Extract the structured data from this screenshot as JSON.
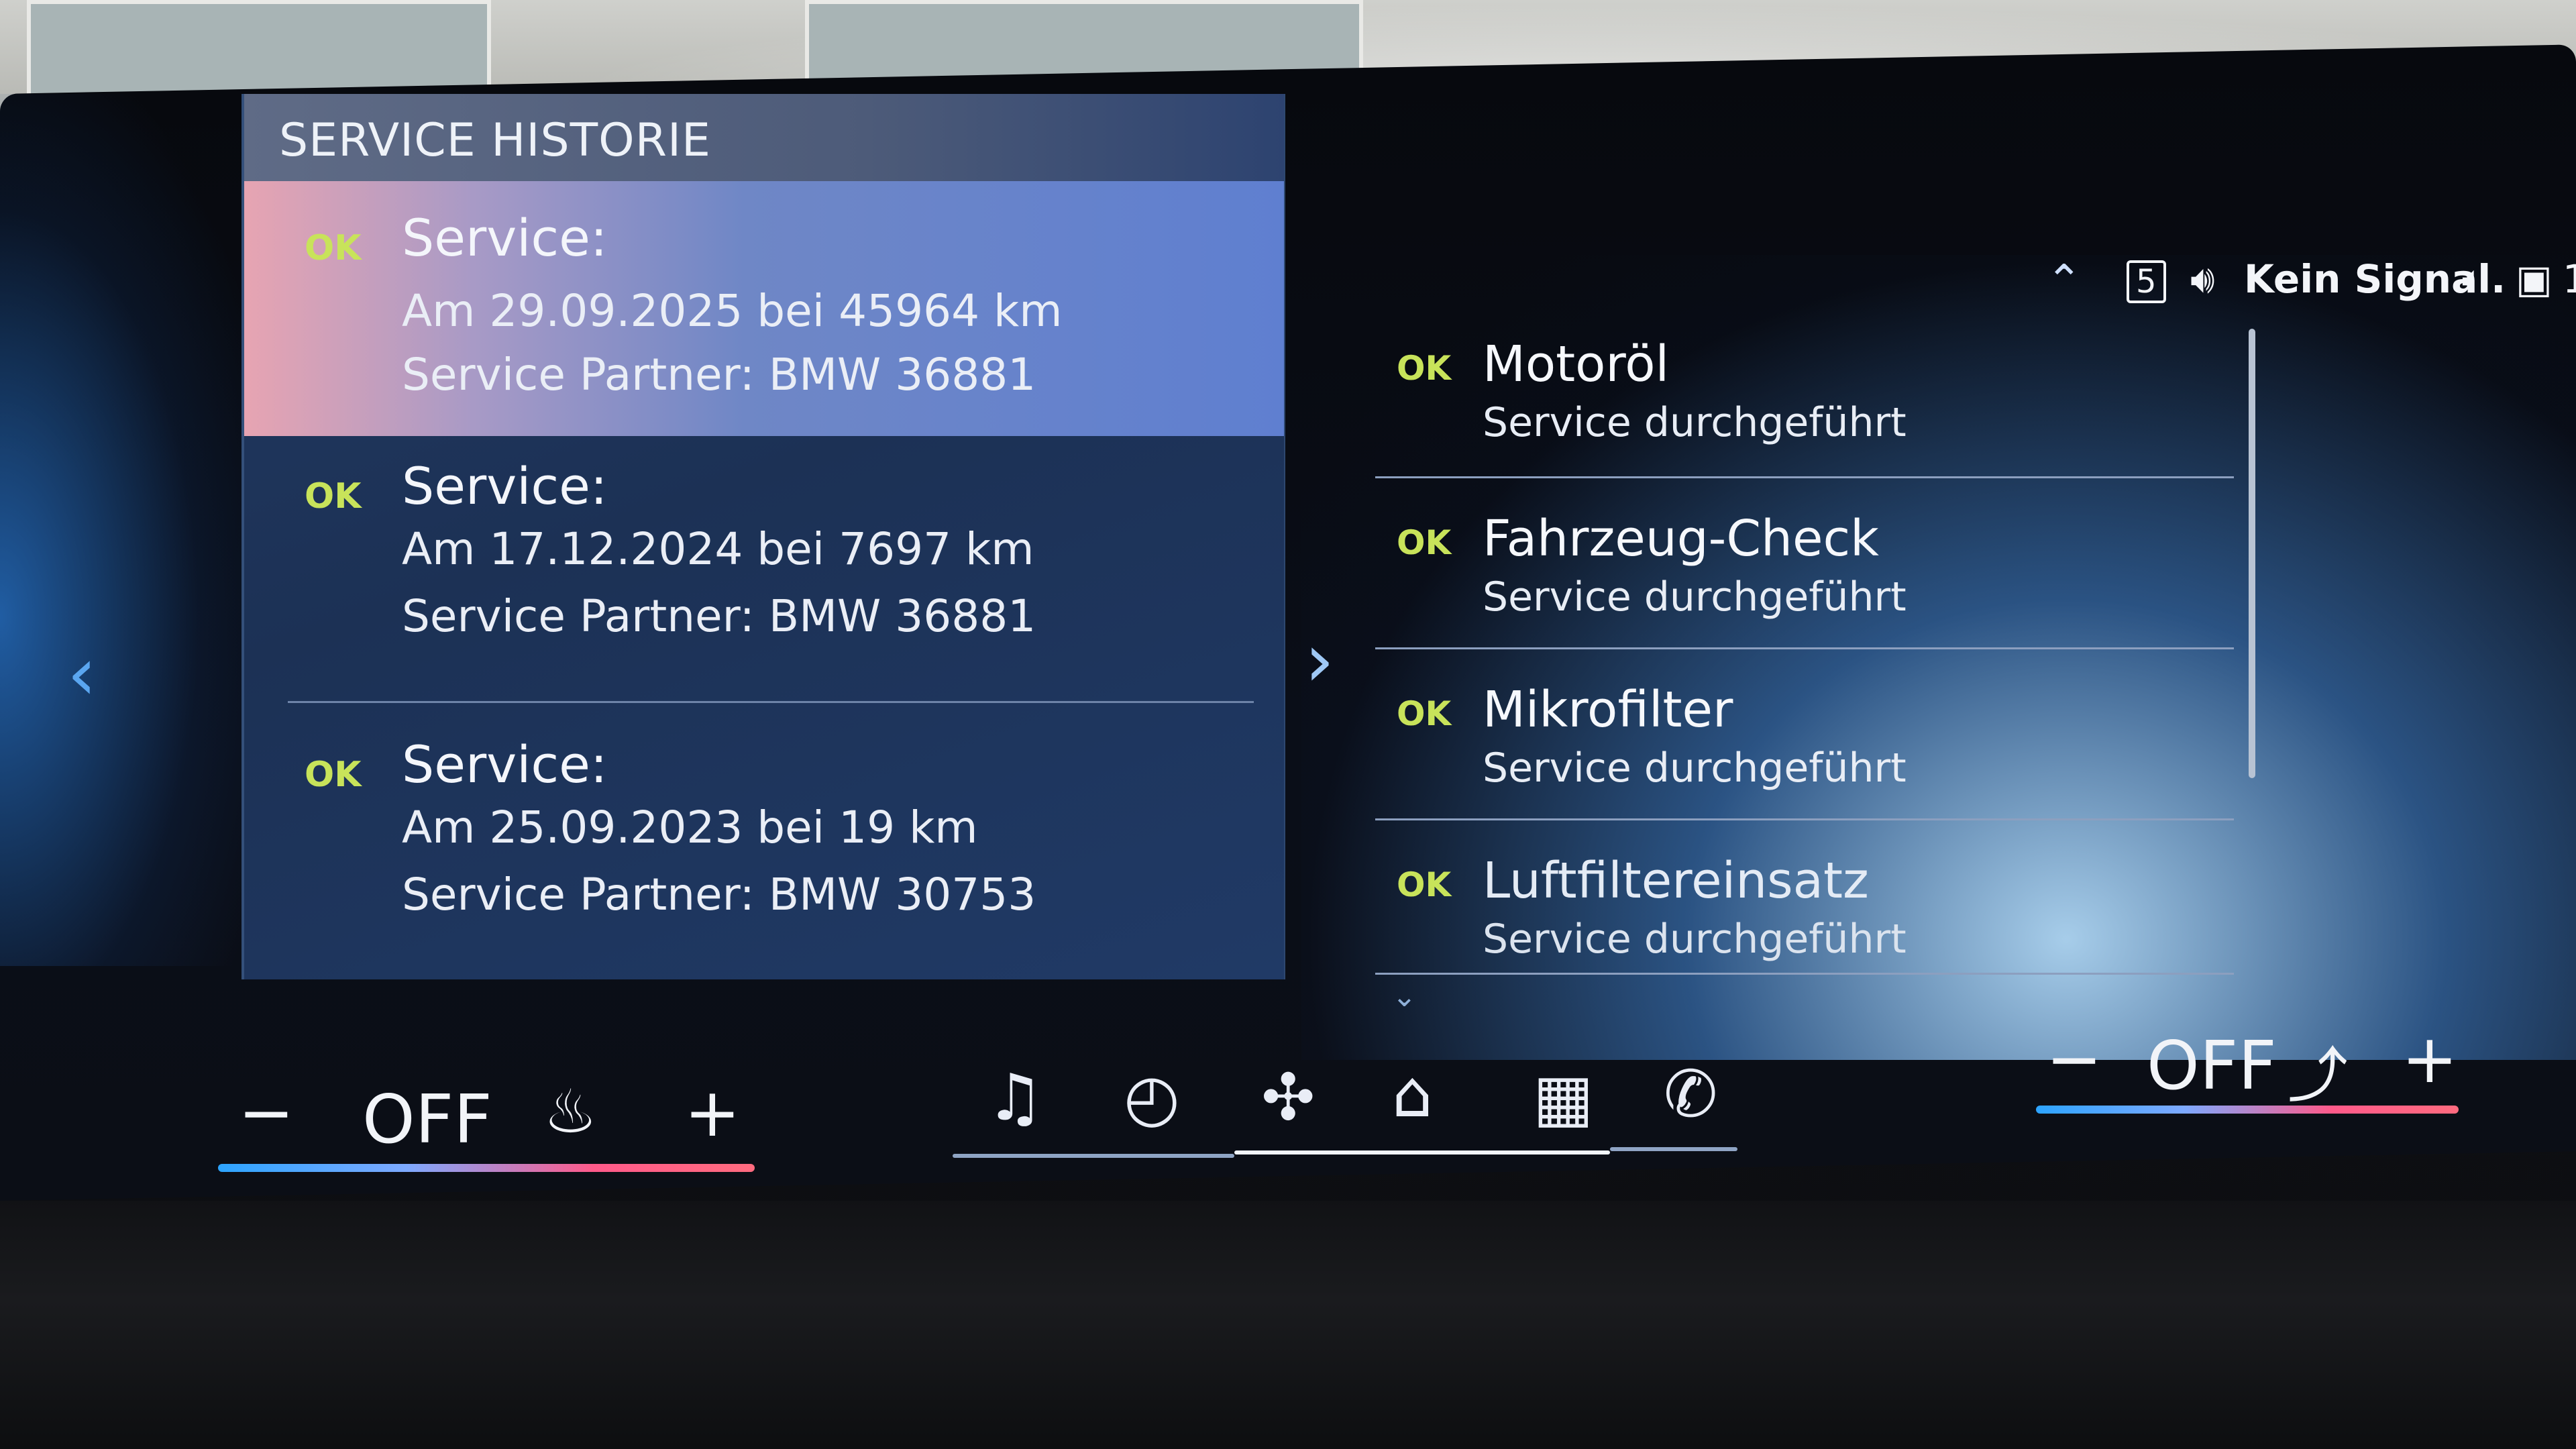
{
  "panel": {
    "title": "SERVICE HISTORIE",
    "entries": [
      {
        "status": "OK",
        "heading": "Service:",
        "date_line": "Am 29.09.2025 bei 45964 km",
        "partner_line": "Service Partner: BMW 36881"
      },
      {
        "status": "OK",
        "heading": "Service:",
        "date_line": "Am 17.12.2024 bei 7697 km",
        "partner_line": "Service Partner: BMW 36881"
      },
      {
        "status": "OK",
        "heading": "Service:",
        "date_line": "Am 25.09.2023 bei 19 km",
        "partner_line": "Service Partner: BMW 30753"
      }
    ]
  },
  "details": [
    {
      "status": "OK",
      "title": "Motoröl",
      "subtitle": "Service durchgeführt"
    },
    {
      "status": "OK",
      "title": "Fahrzeug-Check",
      "subtitle": "Service durchgeführt"
    },
    {
      "status": "OK",
      "title": "Mikrofilter",
      "subtitle": "Service durchgeführt"
    },
    {
      "status": "OK",
      "title": "Luftfiltereinsatz",
      "subtitle": "Service durchgeführt"
    }
  ],
  "status_bar": {
    "network": "5",
    "signal_text": "Kein Signal.",
    "profile_count": "1"
  },
  "climate_left": {
    "minus": "−",
    "label": "OFF",
    "plus": "+"
  },
  "climate_right": {
    "minus": "−",
    "label": "OFF",
    "plus": "+"
  },
  "icons": {
    "nav_prev": "chevron-left-icon",
    "nav_next": "chevron-right-icon",
    "media": "music-note-icon",
    "navigation": "compass-icon",
    "fan": "fan-icon",
    "home": "home-icon",
    "apps": "apps-grid-icon",
    "phone": "phone-icon"
  },
  "colors": {
    "ok": "#c8e35a",
    "selected_row": "#6f87c6"
  }
}
